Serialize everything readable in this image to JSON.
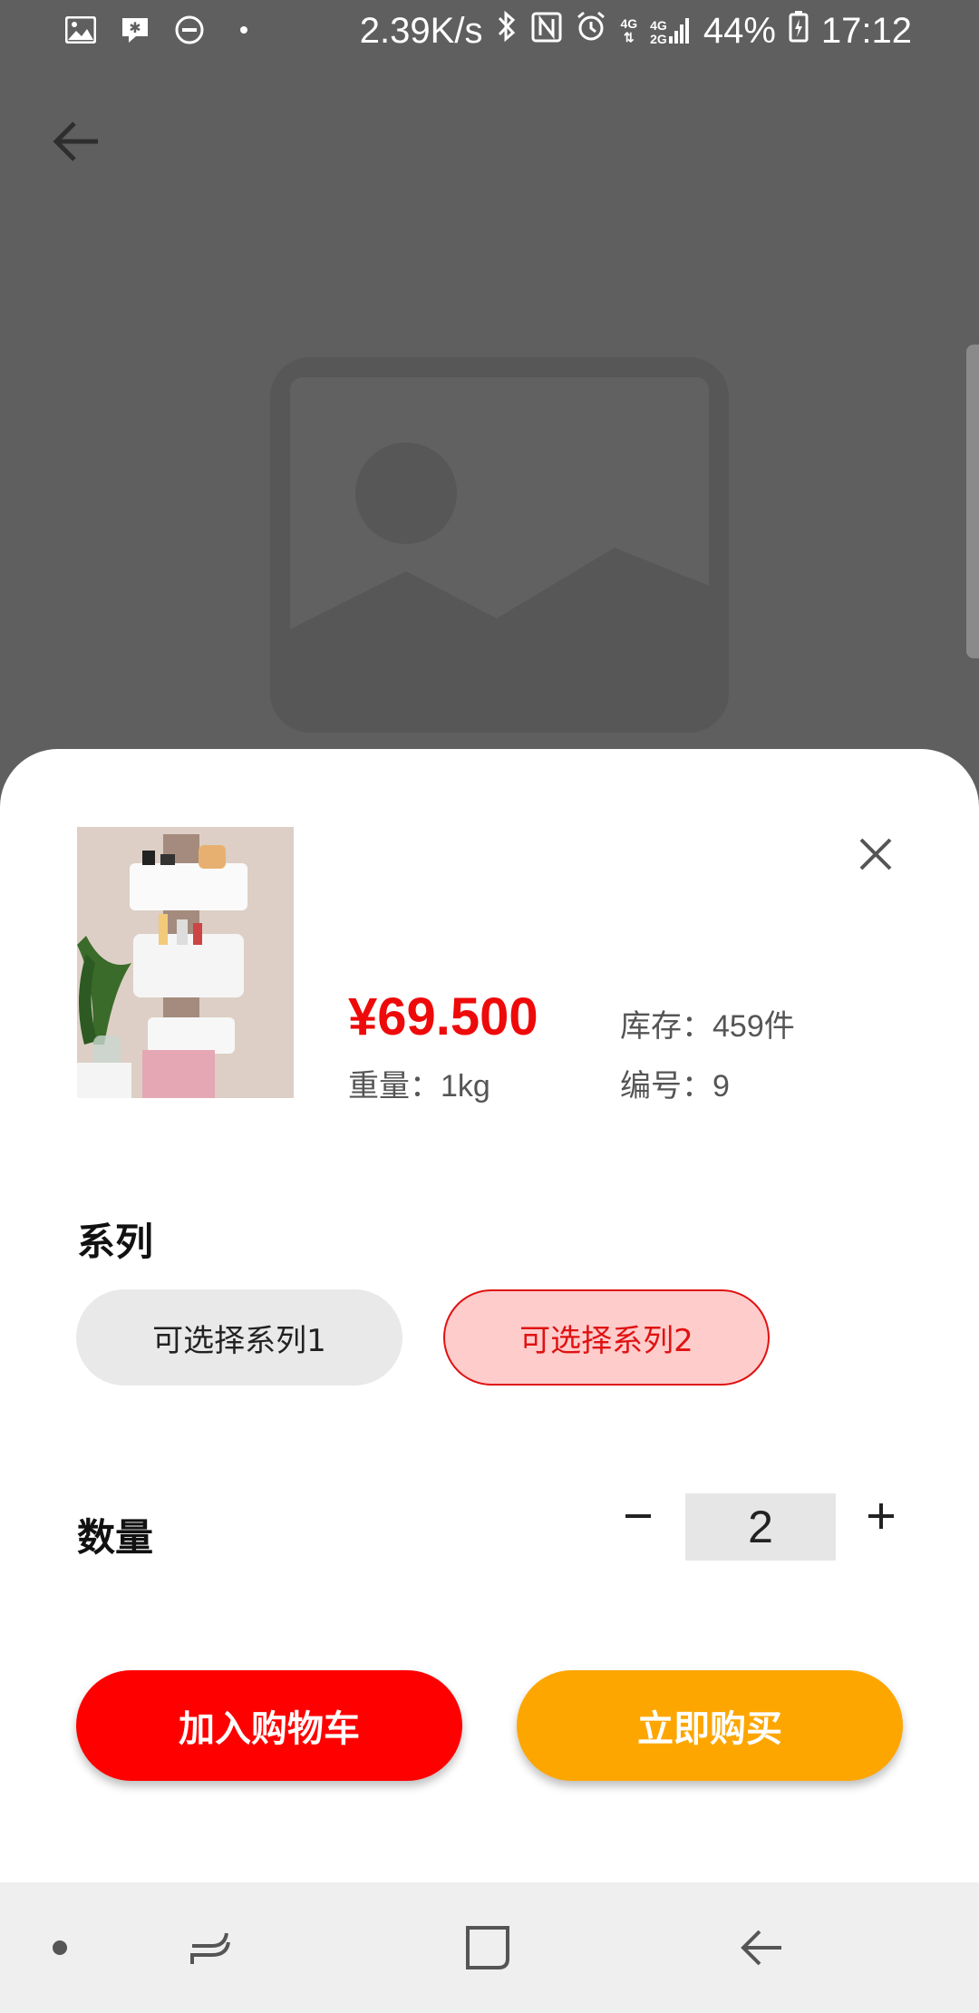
{
  "status_bar": {
    "speed": "2.39K/s",
    "net_top": "4G",
    "net_left": "4G",
    "net_right": "2G",
    "battery": "44%",
    "time": "17:12"
  },
  "product": {
    "price": "¥69.500",
    "weight": "重量：1kg",
    "stock": "库存：459件",
    "code": "编号：9"
  },
  "series": {
    "title": "系列",
    "options": [
      "可选择系列1",
      "可选择系列2"
    ],
    "selected_index": 1
  },
  "quantity": {
    "title": "数量",
    "value": "2",
    "minus": "−",
    "plus": "+"
  },
  "actions": {
    "add_to_cart": "加入购物车",
    "buy_now": "立即购买"
  },
  "colors": {
    "price": "#ee0a0a",
    "add_to_cart": "#ff0000",
    "buy_now": "#fda600",
    "selected_bg": "#ffcccc"
  }
}
